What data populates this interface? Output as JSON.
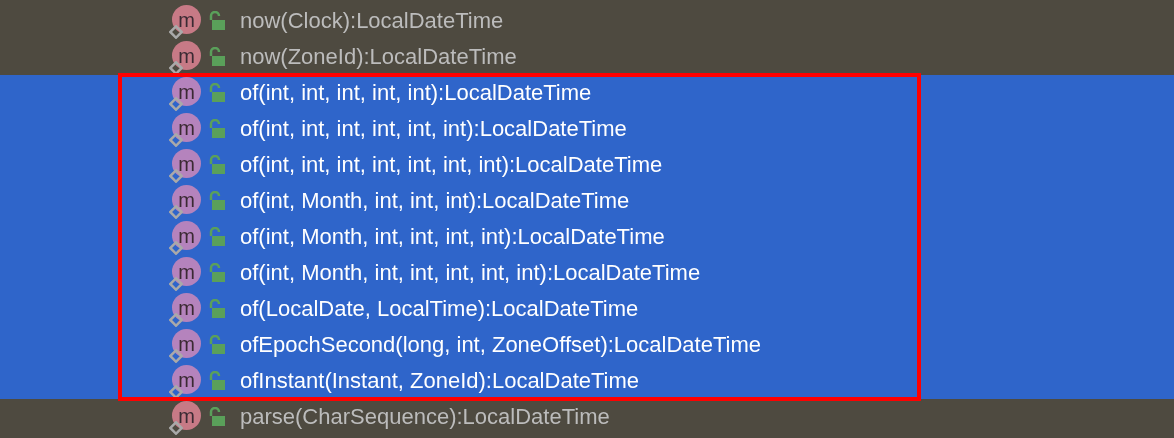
{
  "completion_list": {
    "items": [
      {
        "icon_letter": "m",
        "label": "now(Clock):LocalDateTime",
        "selected": false
      },
      {
        "icon_letter": "m",
        "label": "now(ZoneId):LocalDateTime",
        "selected": false
      },
      {
        "icon_letter": "m",
        "label": "of(int, int, int, int, int):LocalDateTime",
        "selected": true
      },
      {
        "icon_letter": "m",
        "label": "of(int, int, int, int, int, int):LocalDateTime",
        "selected": true
      },
      {
        "icon_letter": "m",
        "label": "of(int, int, int, int, int, int, int):LocalDateTime",
        "selected": true
      },
      {
        "icon_letter": "m",
        "label": "of(int, Month, int, int, int):LocalDateTime",
        "selected": true
      },
      {
        "icon_letter": "m",
        "label": "of(int, Month, int, int, int, int):LocalDateTime",
        "selected": true
      },
      {
        "icon_letter": "m",
        "label": "of(int, Month, int, int, int, int, int):LocalDateTime",
        "selected": true
      },
      {
        "icon_letter": "m",
        "label": "of(LocalDate, LocalTime):LocalDateTime",
        "selected": true
      },
      {
        "icon_letter": "m",
        "label": "ofEpochSecond(long, int, ZoneOffset):LocalDateTime",
        "selected": true
      },
      {
        "icon_letter": "m",
        "label": "ofInstant(Instant, ZoneId):LocalDateTime",
        "selected": true
      },
      {
        "icon_letter": "m",
        "label": "parse(CharSequence):LocalDateTime",
        "selected": false
      }
    ]
  }
}
